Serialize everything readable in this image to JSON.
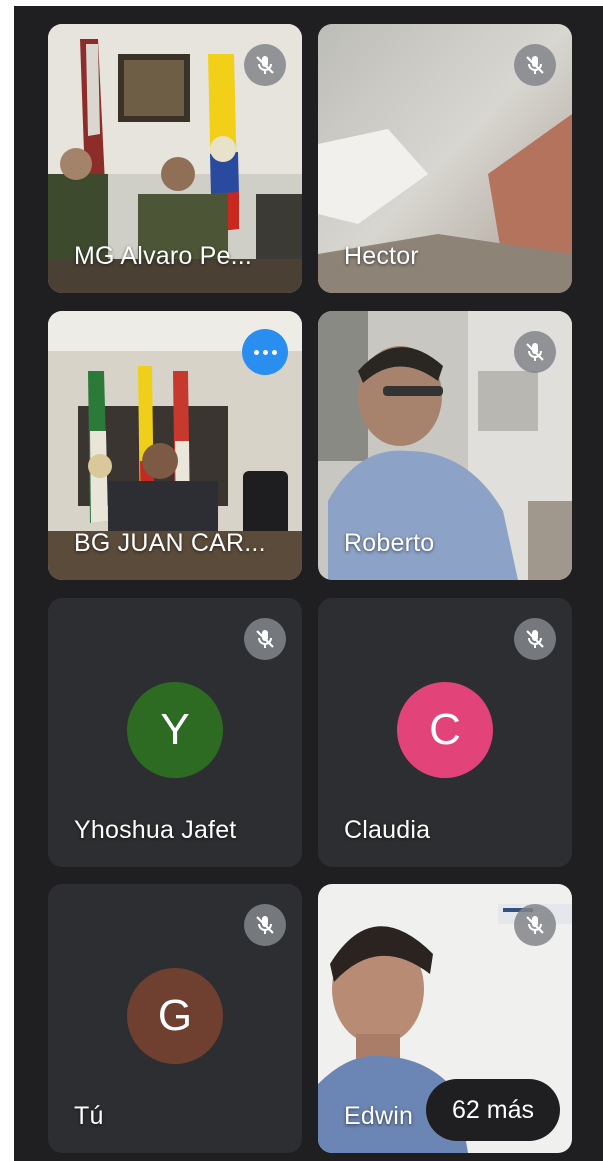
{
  "participants": [
    {
      "name": "MG Alvaro Pe...",
      "muted": true,
      "type": "video"
    },
    {
      "name": "Hector",
      "muted": true,
      "type": "video"
    },
    {
      "name": "BG JUAN CAR...",
      "muted": false,
      "type": "video",
      "options": "more-options-icon"
    },
    {
      "name": "Roberto",
      "muted": true,
      "type": "video"
    },
    {
      "name": "Yhoshua Jafet",
      "muted": true,
      "type": "avatar",
      "initial": "Y",
      "avatar_color": "#2e6b22"
    },
    {
      "name": "Claudia",
      "muted": true,
      "type": "avatar",
      "initial": "C",
      "avatar_color": "#e2447a"
    },
    {
      "name": "Tú",
      "muted": true,
      "type": "avatar",
      "initial": "G",
      "avatar_color": "#6f3f30"
    },
    {
      "name": "Edwin",
      "muted": true,
      "type": "video"
    }
  ],
  "more_participants": "62 más",
  "icons": {
    "mute": "mic-off-icon",
    "options": "more-options-icon"
  },
  "colors": {
    "background": "#1f1f21",
    "tile": "#2d2e31",
    "options_button": "#2a8ef0"
  }
}
